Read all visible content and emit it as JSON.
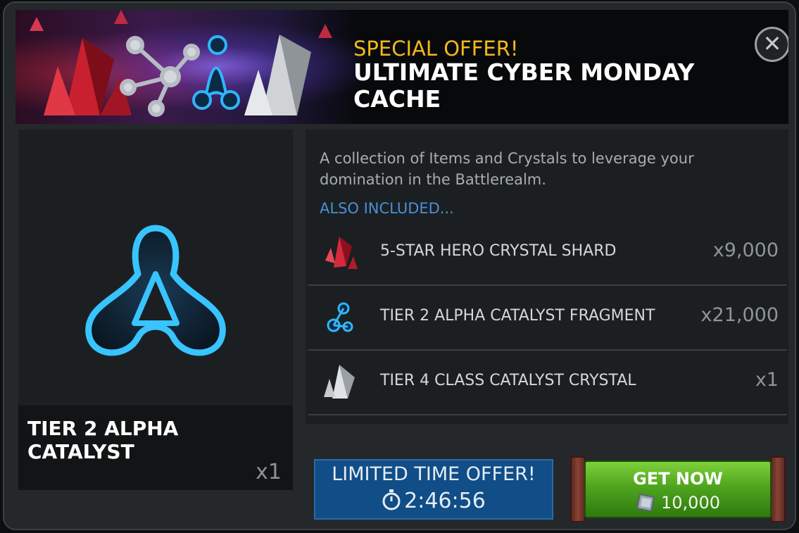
{
  "banner": {
    "eyebrow": "SPECIAL OFFER!",
    "title": "ULTIMATE CYBER MONDAY CACHE",
    "close_icon": "close-icon"
  },
  "featured": {
    "name": "TIER 2 ALPHA CATALYST",
    "quantity": "x1",
    "icon": "alpha-catalyst-icon"
  },
  "details": {
    "description": "A collection of Items and Crystals to leverage your domination in the Battlerealm.",
    "also_included": "ALSO INCLUDED...",
    "items": [
      {
        "label": "5-STAR HERO CRYSTAL SHARD",
        "quantity": "x9,000",
        "icon": "red-crystal-shard-icon"
      },
      {
        "label": "TIER 2 ALPHA CATALYST FRAGMENT",
        "quantity": "x21,000",
        "icon": "catalyst-fragment-icon"
      },
      {
        "label": "TIER 4 CLASS CATALYST CRYSTAL",
        "quantity": "x1",
        "icon": "white-crystal-icon"
      }
    ]
  },
  "timer": {
    "title": "LIMITED TIME OFFER!",
    "remaining": "2:46:56",
    "icon": "stopwatch-icon"
  },
  "purchase": {
    "label": "GET NOW",
    "price": "10,000",
    "currency_icon": "units-icon"
  },
  "colors": {
    "accent_gold": "#f5b81c",
    "link_blue": "#4a8fd8",
    "timer_blue": "#114d86",
    "buy_green": "#4fa41e"
  }
}
